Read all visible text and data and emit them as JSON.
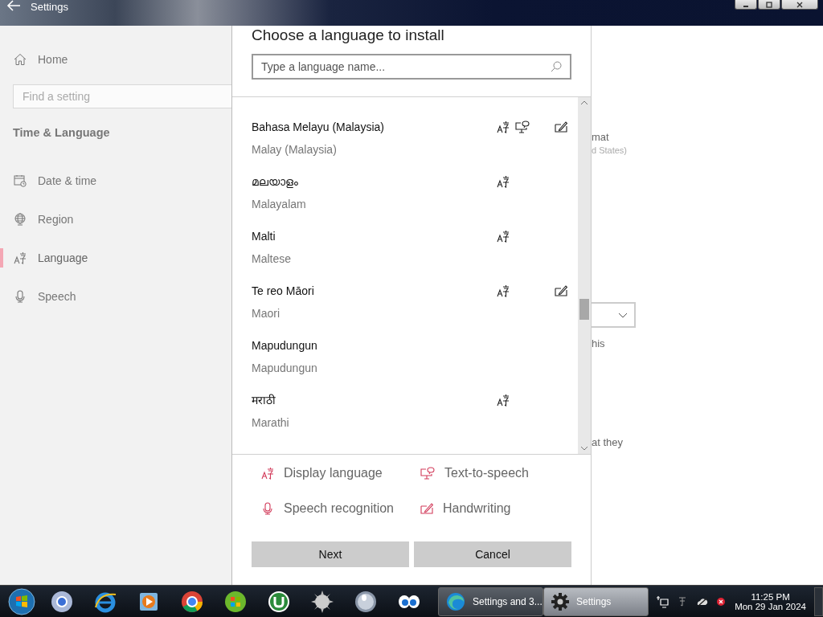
{
  "window": {
    "title": "Settings"
  },
  "sidebar": {
    "home": "Home",
    "search": {
      "placeholder": "Find a setting"
    },
    "heading": "Time & Language",
    "items": [
      {
        "label": "Date & time",
        "kind": "calendar",
        "selected": false
      },
      {
        "label": "Region",
        "kind": "globe",
        "selected": false
      },
      {
        "label": "Language",
        "kind": "language",
        "selected": true
      },
      {
        "label": "Speech",
        "kind": "mic",
        "selected": false
      }
    ]
  },
  "background_page": {
    "line_1": "mat",
    "line_2": "d States)",
    "line_3": "his",
    "line_4": "at they"
  },
  "dialog": {
    "title": "Choose a language to install",
    "search": {
      "placeholder": "Type a language name..."
    },
    "languages": [
      {
        "name": "Bahasa Melayu (Malaysia)",
        "english": "Malay (Malaysia)",
        "display": true,
        "tts": true,
        "speech": false,
        "handwriting": true
      },
      {
        "name": "മലയാളം",
        "english": "Malayalam",
        "display": true,
        "tts": false,
        "speech": false,
        "handwriting": false
      },
      {
        "name": "Malti",
        "english": "Maltese",
        "display": true,
        "tts": false,
        "speech": false,
        "handwriting": false
      },
      {
        "name": "Te reo Māori",
        "english": "Maori",
        "display": true,
        "tts": false,
        "speech": false,
        "handwriting": true
      },
      {
        "name": "Mapudungun",
        "english": "Mapudungun",
        "display": false,
        "tts": false,
        "speech": false,
        "handwriting": false
      },
      {
        "name": "मराठी",
        "english": "Marathi",
        "display": true,
        "tts": false,
        "speech": false,
        "handwriting": false
      }
    ],
    "legend": [
      {
        "kind": "display",
        "label": "Display language"
      },
      {
        "kind": "tts",
        "label": "Text-to-speech"
      },
      {
        "kind": "speech",
        "label": "Speech recognition"
      },
      {
        "kind": "handwriting",
        "label": "Handwriting"
      }
    ],
    "buttons": [
      "Next",
      "Cancel"
    ]
  },
  "taskbar": {
    "tasks": [
      {
        "label": "Settings and 3...",
        "kind": "browser",
        "selected": false
      },
      {
        "label": "Settings",
        "kind": "gear",
        "selected": true
      }
    ],
    "clock": {
      "time": "11:25 PM",
      "date": "Mon 29 Jan 2024"
    }
  }
}
